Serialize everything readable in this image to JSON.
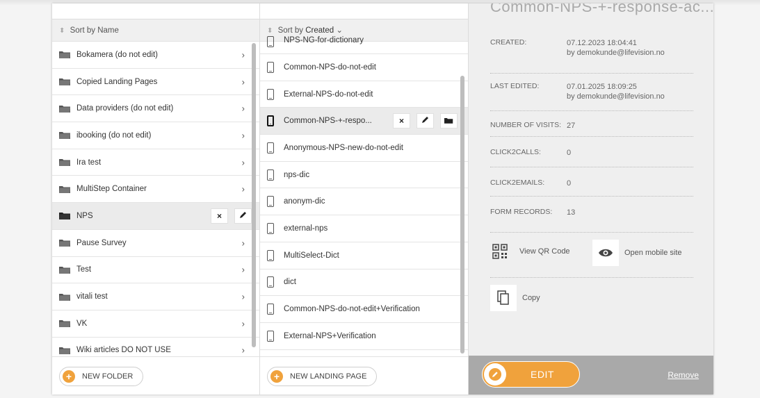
{
  "folders_column": {
    "sort_label": "Sort by Name",
    "items": [
      {
        "label": "Bokamera (do not edit)"
      },
      {
        "label": "Copied Landing Pages"
      },
      {
        "label": "Data providers (do not edit)"
      },
      {
        "label": "ibooking (do not edit)"
      },
      {
        "label": "Ira test"
      },
      {
        "label": "MultiStep Container"
      },
      {
        "label": "NPS"
      },
      {
        "label": "Pause Survey"
      },
      {
        "label": "Test"
      },
      {
        "label": "vitali test"
      },
      {
        "label": "VK"
      },
      {
        "label": "Wiki articles DO NOT USE"
      }
    ],
    "selected_actions": {
      "delete": "×",
      "edit": "✎"
    },
    "new_button": "NEW FOLDER"
  },
  "pages_column": {
    "sort_prefix": "Sort by",
    "sort_value": "Created",
    "sort_caret": "⌄",
    "items": [
      {
        "label": "NPS-NG-for-dictionary"
      },
      {
        "label": "Common-NPS-do-not-edit"
      },
      {
        "label": "External-NPS-do-not-edit"
      },
      {
        "label": "Common-NPS-+-respo..."
      },
      {
        "label": "Anonymous-NPS-new-do-not-edit"
      },
      {
        "label": "nps-dic"
      },
      {
        "label": "anonym-dic"
      },
      {
        "label": "external-nps"
      },
      {
        "label": "MultiSelect-Dict"
      },
      {
        "label": "dict"
      },
      {
        "label": "Common-NPS-do-not-edit+Verification"
      },
      {
        "label": "External-NPS+Verification"
      }
    ],
    "selected_actions": {
      "delete": "×"
    },
    "new_button": "NEW LANDING PAGE"
  },
  "details": {
    "title": "Common-NPS-+-response-ac...",
    "created_label": "CREATED:",
    "created_date": "07.12.2023 18:04:41",
    "created_by": "by demokunde@lifevision.no",
    "edited_label": "LAST EDITED:",
    "edited_date": "07.01.2025 18:09:25",
    "edited_by": "by demokunde@lifevision.no",
    "visits_label": "NUMBER OF VISITS:",
    "visits_value": "27",
    "calls_label": "CLICK2CALLS:",
    "calls_value": "0",
    "emails_label": "CLICK2EMAILS:",
    "emails_value": "0",
    "records_label": "FORM RECORDS:",
    "records_value": "13",
    "qr_label": "View QR Code",
    "mobile_label": "Open mobile site",
    "copy_label": "Copy",
    "edit_label": "EDIT",
    "remove_label": "Remove"
  },
  "colors": {
    "accent": "#f0a23c",
    "edit_bar": "#a9a9a9",
    "details_bg": "#efefef"
  }
}
